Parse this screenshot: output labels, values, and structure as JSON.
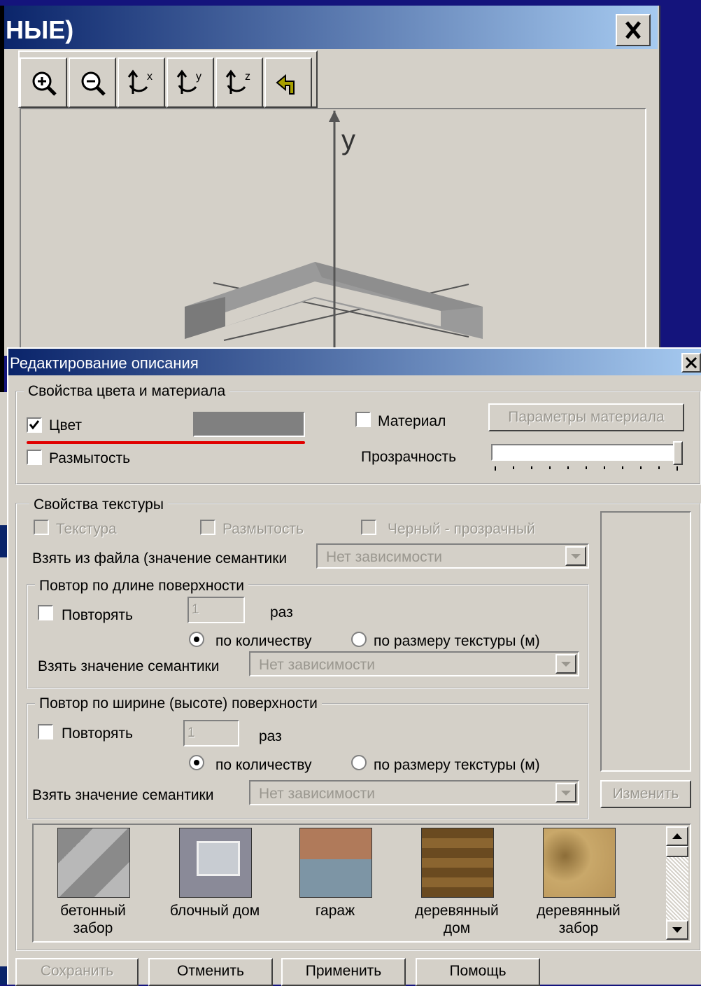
{
  "viewer": {
    "title": "НЫЕ)",
    "close_glyph": "✕",
    "toolbar": [
      "zoom-in-icon",
      "zoom-out-icon",
      "rotate-x-icon",
      "rotate-y-icon",
      "rotate-z-icon",
      "undo-icon"
    ],
    "axis_y_label": "y"
  },
  "dialog": {
    "title": "Редактирование описания",
    "close_glyph": "✕",
    "color_group": {
      "title": "Свойства цвета и материала",
      "color_checkbox": "Цвет",
      "color_checked": true,
      "color_swatch": "#808080",
      "blur_checkbox": "Размытость",
      "material_checkbox": "Материал",
      "material_button": "Параметры материала",
      "transparency_label": "Прозрачность",
      "transparency_value": 1.0
    },
    "texture_group": {
      "title": "Свойства текстуры",
      "texture_checkbox": "Текстура",
      "blur_checkbox": "Размытость",
      "black_transparent_checkbox": "Черный - прозрачный",
      "from_file_label": "Взять из файла (значение семантики",
      "from_file_value": "Нет зависимости",
      "change_button": "Изменить",
      "length_repeat": {
        "title": "Повтор по длине поверхности",
        "repeat_checkbox": "Повторять",
        "count_value": "1",
        "times_label": "раз",
        "radio_by_count": "по количеству",
        "radio_by_size": "по размеру текстуры (м)",
        "semantic_label": "Взять значение семантики",
        "semantic_value": "Нет зависимости"
      },
      "width_repeat": {
        "title": "Повтор по ширине (высоте) поверхности",
        "repeat_checkbox": "Повторять",
        "count_value": "1",
        "times_label": "раз",
        "radio_by_count": "по количеству",
        "radio_by_size": "по размеру текстуры (м)",
        "semantic_label": "Взять  значение семантики",
        "semantic_value": "Нет зависимости"
      },
      "textures": [
        {
          "line1": "бетонный",
          "line2": "забор"
        },
        {
          "line1": "блочный дом",
          "line2": ""
        },
        {
          "line1": "гараж",
          "line2": ""
        },
        {
          "line1": "деревянный",
          "line2": "дом"
        },
        {
          "line1": "деревянный",
          "line2": "забор"
        }
      ]
    },
    "buttons": {
      "save": "Сохранить",
      "cancel": "Отменить",
      "apply": "Применить",
      "help": "Помощь"
    }
  }
}
